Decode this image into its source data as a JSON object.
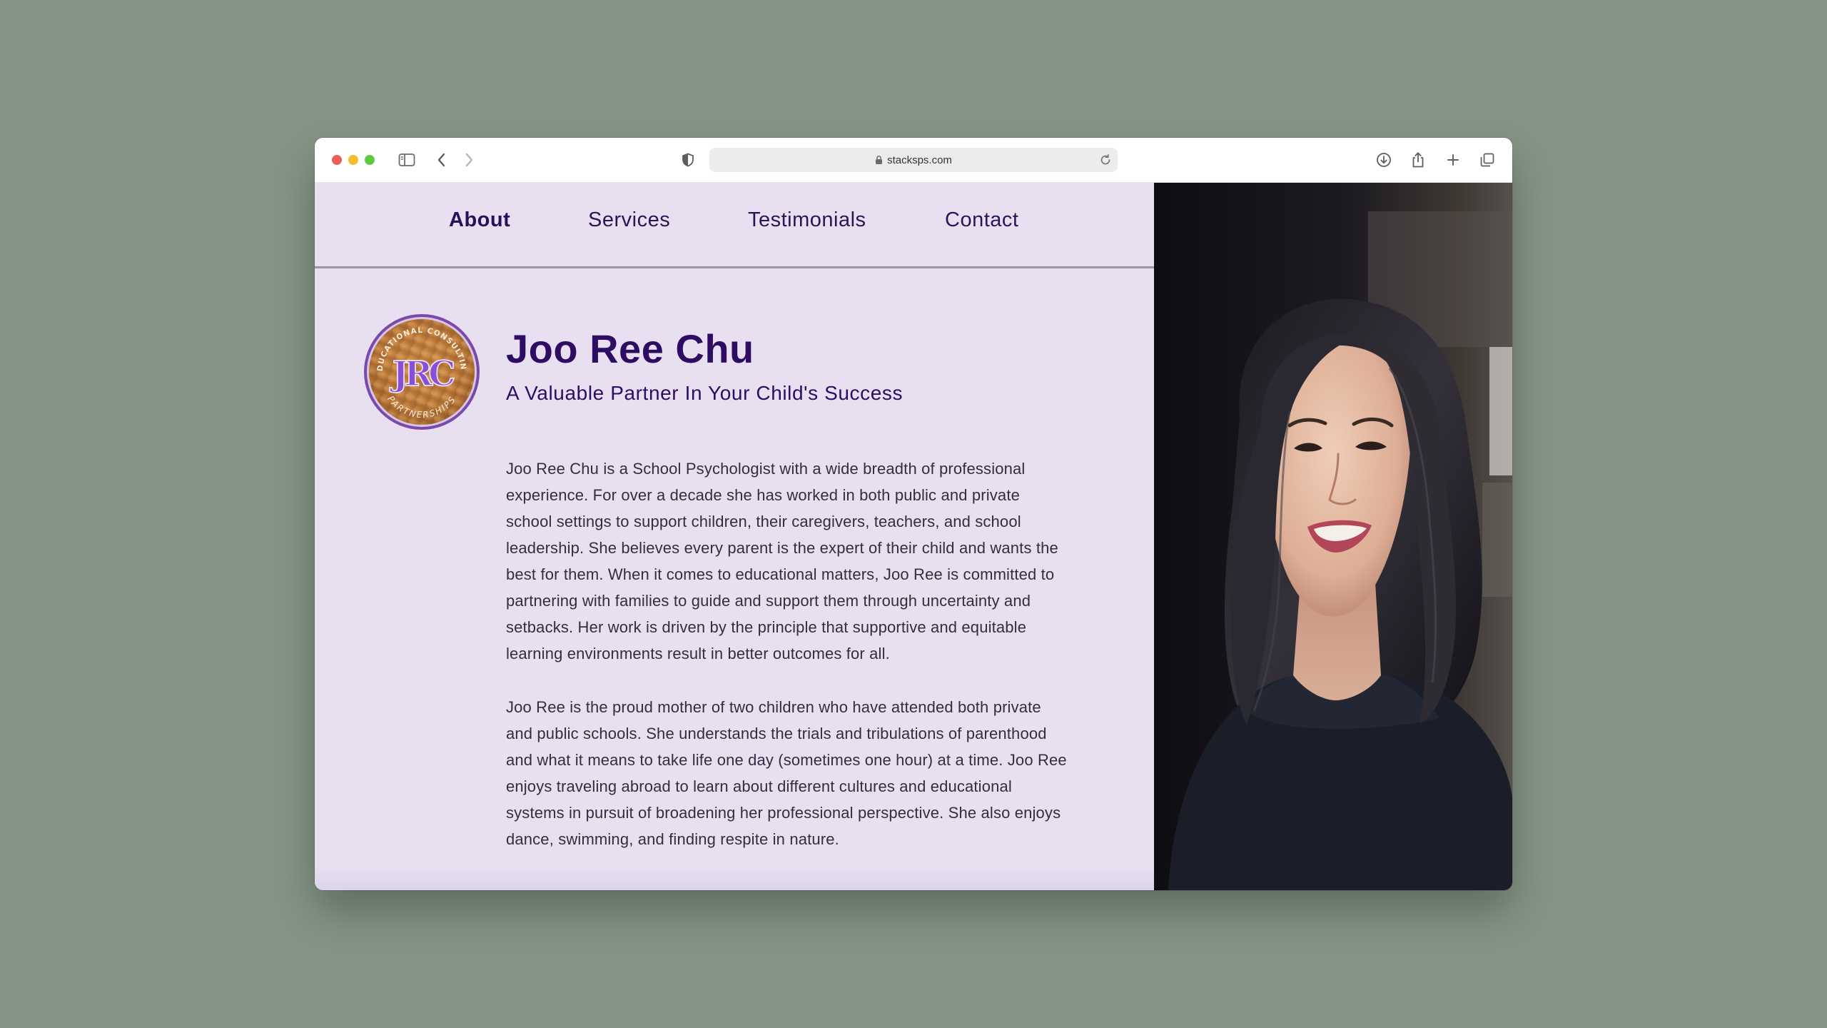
{
  "browser": {
    "url": "stacksps.com"
  },
  "nav": {
    "items": [
      {
        "label": "About",
        "active": true
      },
      {
        "label": "Services",
        "active": false
      },
      {
        "label": "Testimonials",
        "active": false
      },
      {
        "label": "Contact",
        "active": false
      }
    ]
  },
  "hero": {
    "logo_text_top": "EDUCATIONAL CONSULTING",
    "logo_monogram": "JRC",
    "logo_text_bottom": "PARTNERSHIPS",
    "name": "Joo Ree Chu",
    "tagline": "A Valuable Partner In Your Child's Success"
  },
  "bio": {
    "paragraph_1": "Joo Ree Chu is a School Psychologist with a wide breadth of professional experience. For over a decade she has worked in both public and private school settings to support children, their caregivers, teachers, and school leadership. She believes every parent is the expert of their child and wants the best for them. When it comes to educational matters, Joo Ree is committed to partnering with families to guide and support them through uncertainty and setbacks. Her work is driven by the principle that supportive and equitable learning environments result in better outcomes for all.",
    "paragraph_2": "Joo Ree is the proud mother of two children who have attended both private and public schools. She understands the trials and tribulations of parenthood and what it means to take life one day (sometimes one hour) at a time. Joo Ree enjoys traveling abroad to learn about different cultures and educational systems in pursuit of broadening her professional perspective. She also enjoys dance, swimming, and finding respite in nature."
  },
  "colors": {
    "page_background": "#849585",
    "panel_background": "#e8e0f1",
    "accent_purple": "#2e0c63",
    "logo_purple": "#8a4fd6"
  },
  "icons": {
    "toolbar_left": [
      "sidebar-icon",
      "back-icon",
      "forward-icon"
    ],
    "toolbar_right": [
      "download-icon",
      "share-icon",
      "new-tab-icon",
      "tabs-overview-icon"
    ],
    "url_bar": [
      "privacy-shield-icon",
      "lock-icon",
      "reload-icon"
    ]
  }
}
